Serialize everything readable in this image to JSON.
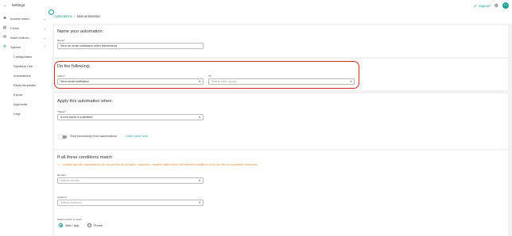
{
  "sidebar": {
    "back_label": "Settings",
    "items": [
      {
        "label": "Access mana...",
        "icon": "person-icon"
      },
      {
        "label": "Forms",
        "icon": "document-icon"
      },
      {
        "label": "Issue custom...",
        "icon": "wrench-icon"
      },
      {
        "label": "System",
        "icon": "gear-icon"
      }
    ],
    "subitems": [
      "Configuration",
      "SpeakUp Hub",
      "Automations",
      "Reply templates",
      "Export",
      "Approvals",
      "Logs"
    ]
  },
  "header": {
    "breadcrumb_parent": "Automations",
    "breadcrumb_current": "New automation",
    "support_label": "Support",
    "avatar_initials": "TT"
  },
  "name_section": {
    "title": "Name your automation:",
    "name_label": "Name*",
    "name_value": "Send an email notification when Netherlands"
  },
  "action_section": {
    "title": "Do the following:",
    "action_label": "Action*",
    "action_value": "Send email notification",
    "to_label": "To*",
    "to_placeholder": "Search user / group"
  },
  "trigger_section": {
    "title": "Apply this automation when:",
    "trigger_label": "Trigger*",
    "trigger_value": "A new report is submitted",
    "stop_label": "Stop processing more automations",
    "learn_more": "Learn more here"
  },
  "conditions_section": {
    "title": "If all these conditions match",
    "warning": "Country-specific automations will not access all domains / channels / weather stake fields. All selected conditions must be met for successful execution.",
    "domain_label": "Domain",
    "domain_placeholder": "Search domain",
    "channel_label": "Channel",
    "channel_placeholder": "Search channels",
    "source_label": "Select source of report",
    "source_options": [
      "Web / App",
      "Phone"
    ],
    "source_selected": "Web / App"
  },
  "colors": {
    "accent": "#1e9f8e",
    "highlight": "#d12b2b",
    "warning": "#e8862a"
  }
}
